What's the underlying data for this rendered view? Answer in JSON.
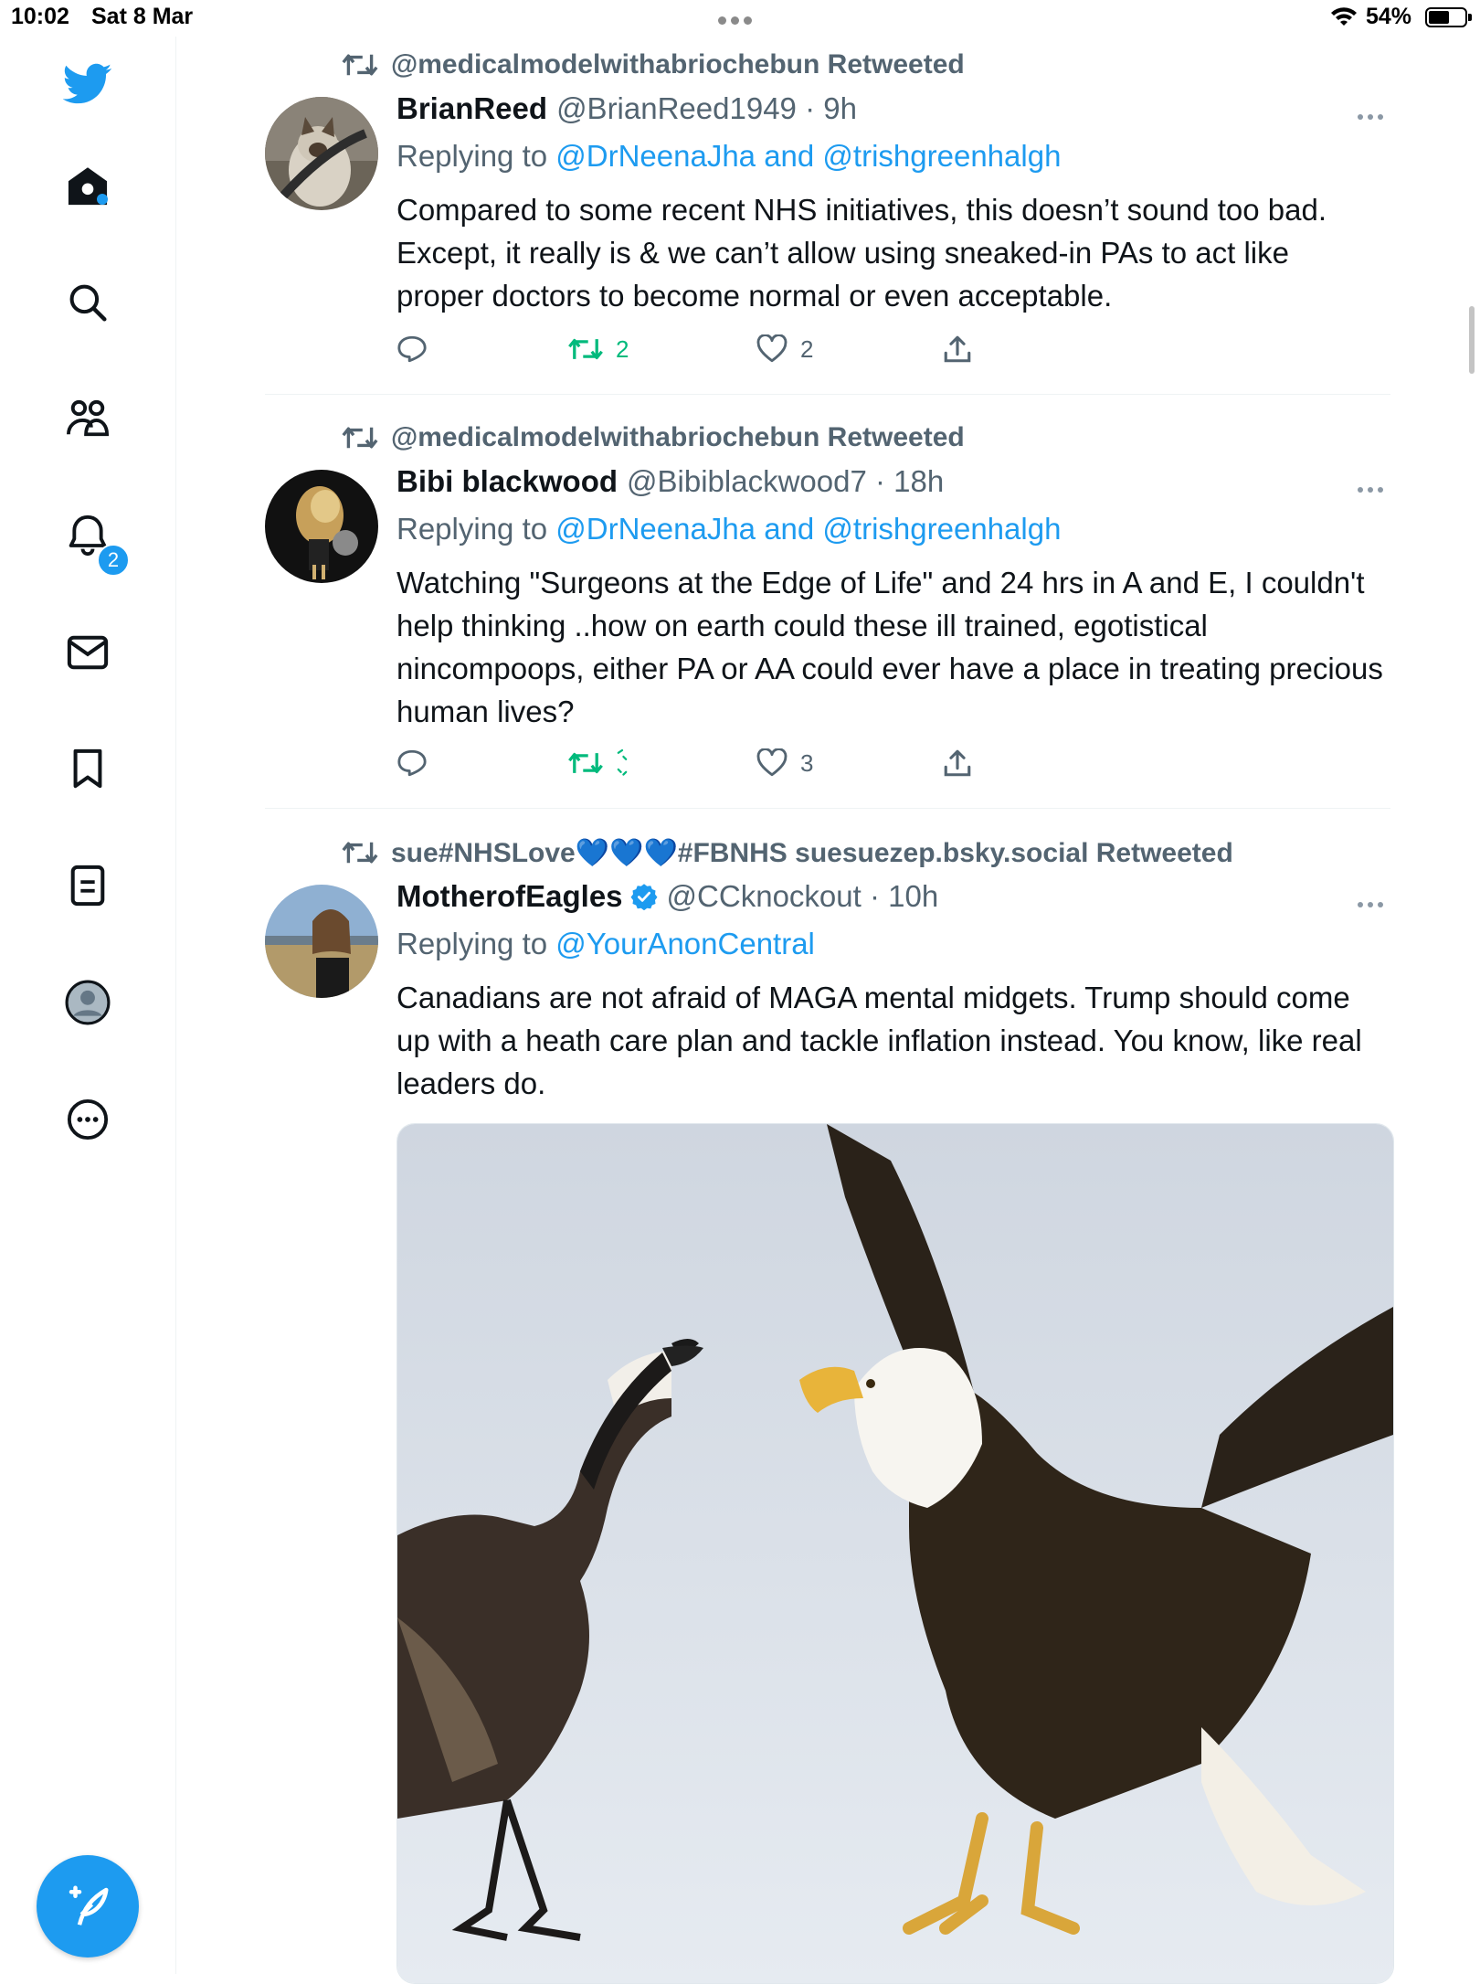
{
  "status_bar": {
    "time": "10:02",
    "date": "Sat 8 Mar",
    "battery": "54%"
  },
  "sidebar": {
    "notification_badge": "2",
    "items": [
      {
        "icon": "home-icon"
      },
      {
        "icon": "search-icon"
      },
      {
        "icon": "communities-icon"
      },
      {
        "icon": "notifications-icon"
      },
      {
        "icon": "messages-icon"
      },
      {
        "icon": "bookmarks-icon"
      },
      {
        "icon": "lists-icon"
      },
      {
        "icon": "profile-icon"
      },
      {
        "icon": "more-icon"
      }
    ]
  },
  "tweets": [
    {
      "retweeted_by": "@medicalmodelwithabriochebun Retweeted",
      "name": "BrianReed",
      "handle": "@BrianReed1949 · 9h",
      "replying_prefix": "Replying to ",
      "replying_to": "@DrNeenaJha and @trishgreenhalgh",
      "text": "Compared to some recent NHS initiatives, this doesn’t sound too bad. Except, it really is & we can’t allow using sneaked-in PAs to act like proper doctors to become normal or even acceptable.",
      "retweets": "2",
      "likes": "2"
    },
    {
      "retweeted_by": "@medicalmodelwithabriochebun Retweeted",
      "name": "Bibi blackwood",
      "handle": "@Bibiblackwood7 · 18h",
      "replying_prefix": "Replying to ",
      "replying_to": "@DrNeenaJha and @trishgreenhalgh",
      "text": "Watching \"Surgeons at the Edge of Life\" and 24 hrs in A and E,  I couldn't help thinking ..how on earth could these ill trained, egotistical nincompoops, either PA or AA could ever have a place in treating precious human lives?",
      "retweets": "",
      "likes": "3"
    },
    {
      "retweeted_by": "sue#NHSLove💙💙💙#FBNHS suesuezep.bsky.social Retweeted",
      "name": "MotherofEagles",
      "handle": "@CCknockout · 10h",
      "replying_prefix": "Replying to ",
      "replying_to": "@YourAnonCentral",
      "text": "Canadians are not afraid of MAGA mental midgets. Trump should come up with a heath care plan and tackle inflation instead. You know, like real leaders do."
    }
  ],
  "colors": {
    "accent": "#1d9bf0",
    "retweet_green": "#00ba7c",
    "secondary_text": "#536471"
  }
}
